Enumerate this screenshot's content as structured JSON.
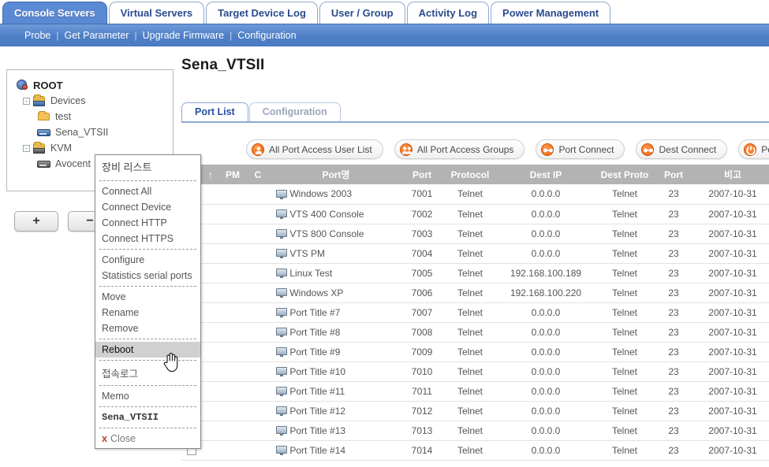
{
  "nav": {
    "tabs": [
      {
        "label": "Console Servers",
        "active": true
      },
      {
        "label": "Virtual Servers",
        "active": false
      },
      {
        "label": "Target Device Log",
        "active": false
      },
      {
        "label": "User / Group",
        "active": false
      },
      {
        "label": "Activity Log",
        "active": false
      },
      {
        "label": "Power Management",
        "active": false
      }
    ],
    "subnav": [
      "Probe",
      "Get Parameter",
      "Upgrade Firmware",
      "Configuration"
    ]
  },
  "tree": {
    "root_label": "ROOT",
    "nodes": [
      {
        "label": "Devices",
        "icon": "folder-device-icon",
        "level": 1,
        "expander": "-"
      },
      {
        "label": "test",
        "icon": "folder-icon",
        "level": 2,
        "expander": ""
      },
      {
        "label": "Sena_VTSII",
        "icon": "device-icon",
        "level": 2,
        "expander": ""
      },
      {
        "label": "KVM",
        "icon": "folder-device-gray-icon",
        "level": 1,
        "expander": "-"
      },
      {
        "label": "Avocent",
        "icon": "device-gray-icon",
        "level": 2,
        "expander": ""
      }
    ],
    "add_label": "+",
    "remove_label": "−"
  },
  "main": {
    "page_title": "Sena_VTSII",
    "subtabs": [
      {
        "label": "Port List",
        "active": true
      },
      {
        "label": "Configuration",
        "active": false
      }
    ],
    "actions": [
      {
        "label": "All Port Access User List",
        "icon": "user-icon"
      },
      {
        "label": "All Port Access Groups",
        "icon": "group-icon"
      },
      {
        "label": "Port Connect",
        "icon": "connect-icon"
      },
      {
        "label": "Dest Connect",
        "icon": "connect-icon"
      },
      {
        "label": "Port Reset",
        "icon": "power-icon"
      }
    ]
  },
  "table": {
    "headers": [
      "",
      "↑",
      "PM",
      "C",
      "Port명",
      "Port",
      "Protocol",
      "Dest IP",
      "Dest Proto",
      "Port",
      "비고"
    ],
    "rows": [
      {
        "name": "Windows 2003",
        "port": "7001",
        "protocol": "Telnet",
        "dest_ip": "0.0.0.0",
        "dest_proto": "Telnet",
        "dest_port": "23",
        "memo": "2007-10-31"
      },
      {
        "name": "VTS 400 Console",
        "port": "7002",
        "protocol": "Telnet",
        "dest_ip": "0.0.0.0",
        "dest_proto": "Telnet",
        "dest_port": "23",
        "memo": "2007-10-31"
      },
      {
        "name": "VTS 800 Console",
        "port": "7003",
        "protocol": "Telnet",
        "dest_ip": "0.0.0.0",
        "dest_proto": "Telnet",
        "dest_port": "23",
        "memo": "2007-10-31"
      },
      {
        "name": "VTS PM",
        "port": "7004",
        "protocol": "Telnet",
        "dest_ip": "0.0.0.0",
        "dest_proto": "Telnet",
        "dest_port": "23",
        "memo": "2007-10-31"
      },
      {
        "name": "Linux Test",
        "port": "7005",
        "protocol": "Telnet",
        "dest_ip": "192.168.100.189",
        "dest_proto": "Telnet",
        "dest_port": "23",
        "memo": "2007-10-31"
      },
      {
        "name": "Windows XP",
        "port": "7006",
        "protocol": "Telnet",
        "dest_ip": "192.168.100.220",
        "dest_proto": "Telnet",
        "dest_port": "23",
        "memo": "2007-10-31"
      },
      {
        "name": "Port Title #7",
        "port": "7007",
        "protocol": "Telnet",
        "dest_ip": "0.0.0.0",
        "dest_proto": "Telnet",
        "dest_port": "23",
        "memo": "2007-10-31"
      },
      {
        "name": "Port Title #8",
        "port": "7008",
        "protocol": "Telnet",
        "dest_ip": "0.0.0.0",
        "dest_proto": "Telnet",
        "dest_port": "23",
        "memo": "2007-10-31"
      },
      {
        "name": "Port Title #9",
        "port": "7009",
        "protocol": "Telnet",
        "dest_ip": "0.0.0.0",
        "dest_proto": "Telnet",
        "dest_port": "23",
        "memo": "2007-10-31"
      },
      {
        "name": "Port Title #10",
        "port": "7010",
        "protocol": "Telnet",
        "dest_ip": "0.0.0.0",
        "dest_proto": "Telnet",
        "dest_port": "23",
        "memo": "2007-10-31"
      },
      {
        "name": "Port Title #11",
        "port": "7011",
        "protocol": "Telnet",
        "dest_ip": "0.0.0.0",
        "dest_proto": "Telnet",
        "dest_port": "23",
        "memo": "2007-10-31"
      },
      {
        "name": "Port Title #12",
        "port": "7012",
        "protocol": "Telnet",
        "dest_ip": "0.0.0.0",
        "dest_proto": "Telnet",
        "dest_port": "23",
        "memo": "2007-10-31"
      },
      {
        "name": "Port Title #13",
        "port": "7013",
        "protocol": "Telnet",
        "dest_ip": "0.0.0.0",
        "dest_proto": "Telnet",
        "dest_port": "23",
        "memo": "2007-10-31"
      },
      {
        "name": "Port Title #14",
        "port": "7014",
        "protocol": "Telnet",
        "dest_ip": "0.0.0.0",
        "dest_proto": "Telnet",
        "dest_port": "23",
        "memo": "2007-10-31"
      }
    ]
  },
  "context_menu": {
    "header": "장비 리스트",
    "groups": [
      [
        "Connect All",
        "Connect Device",
        "Connect HTTP",
        "Connect HTTPS"
      ],
      [
        "Configure",
        "Statistics serial ports"
      ],
      [
        "Move",
        "Rename",
        "Remove"
      ],
      [
        "Reboot"
      ],
      [
        "접속로그"
      ],
      [
        "Memo"
      ]
    ],
    "selected": "Reboot",
    "device_label": "Sena_VTSII",
    "close_label": "Close",
    "close_mark": "x"
  },
  "colors": {
    "accent_blue": "#5b8ad4",
    "accent_orange": "#ec6209",
    "header_gray": "#b3b3b3"
  }
}
